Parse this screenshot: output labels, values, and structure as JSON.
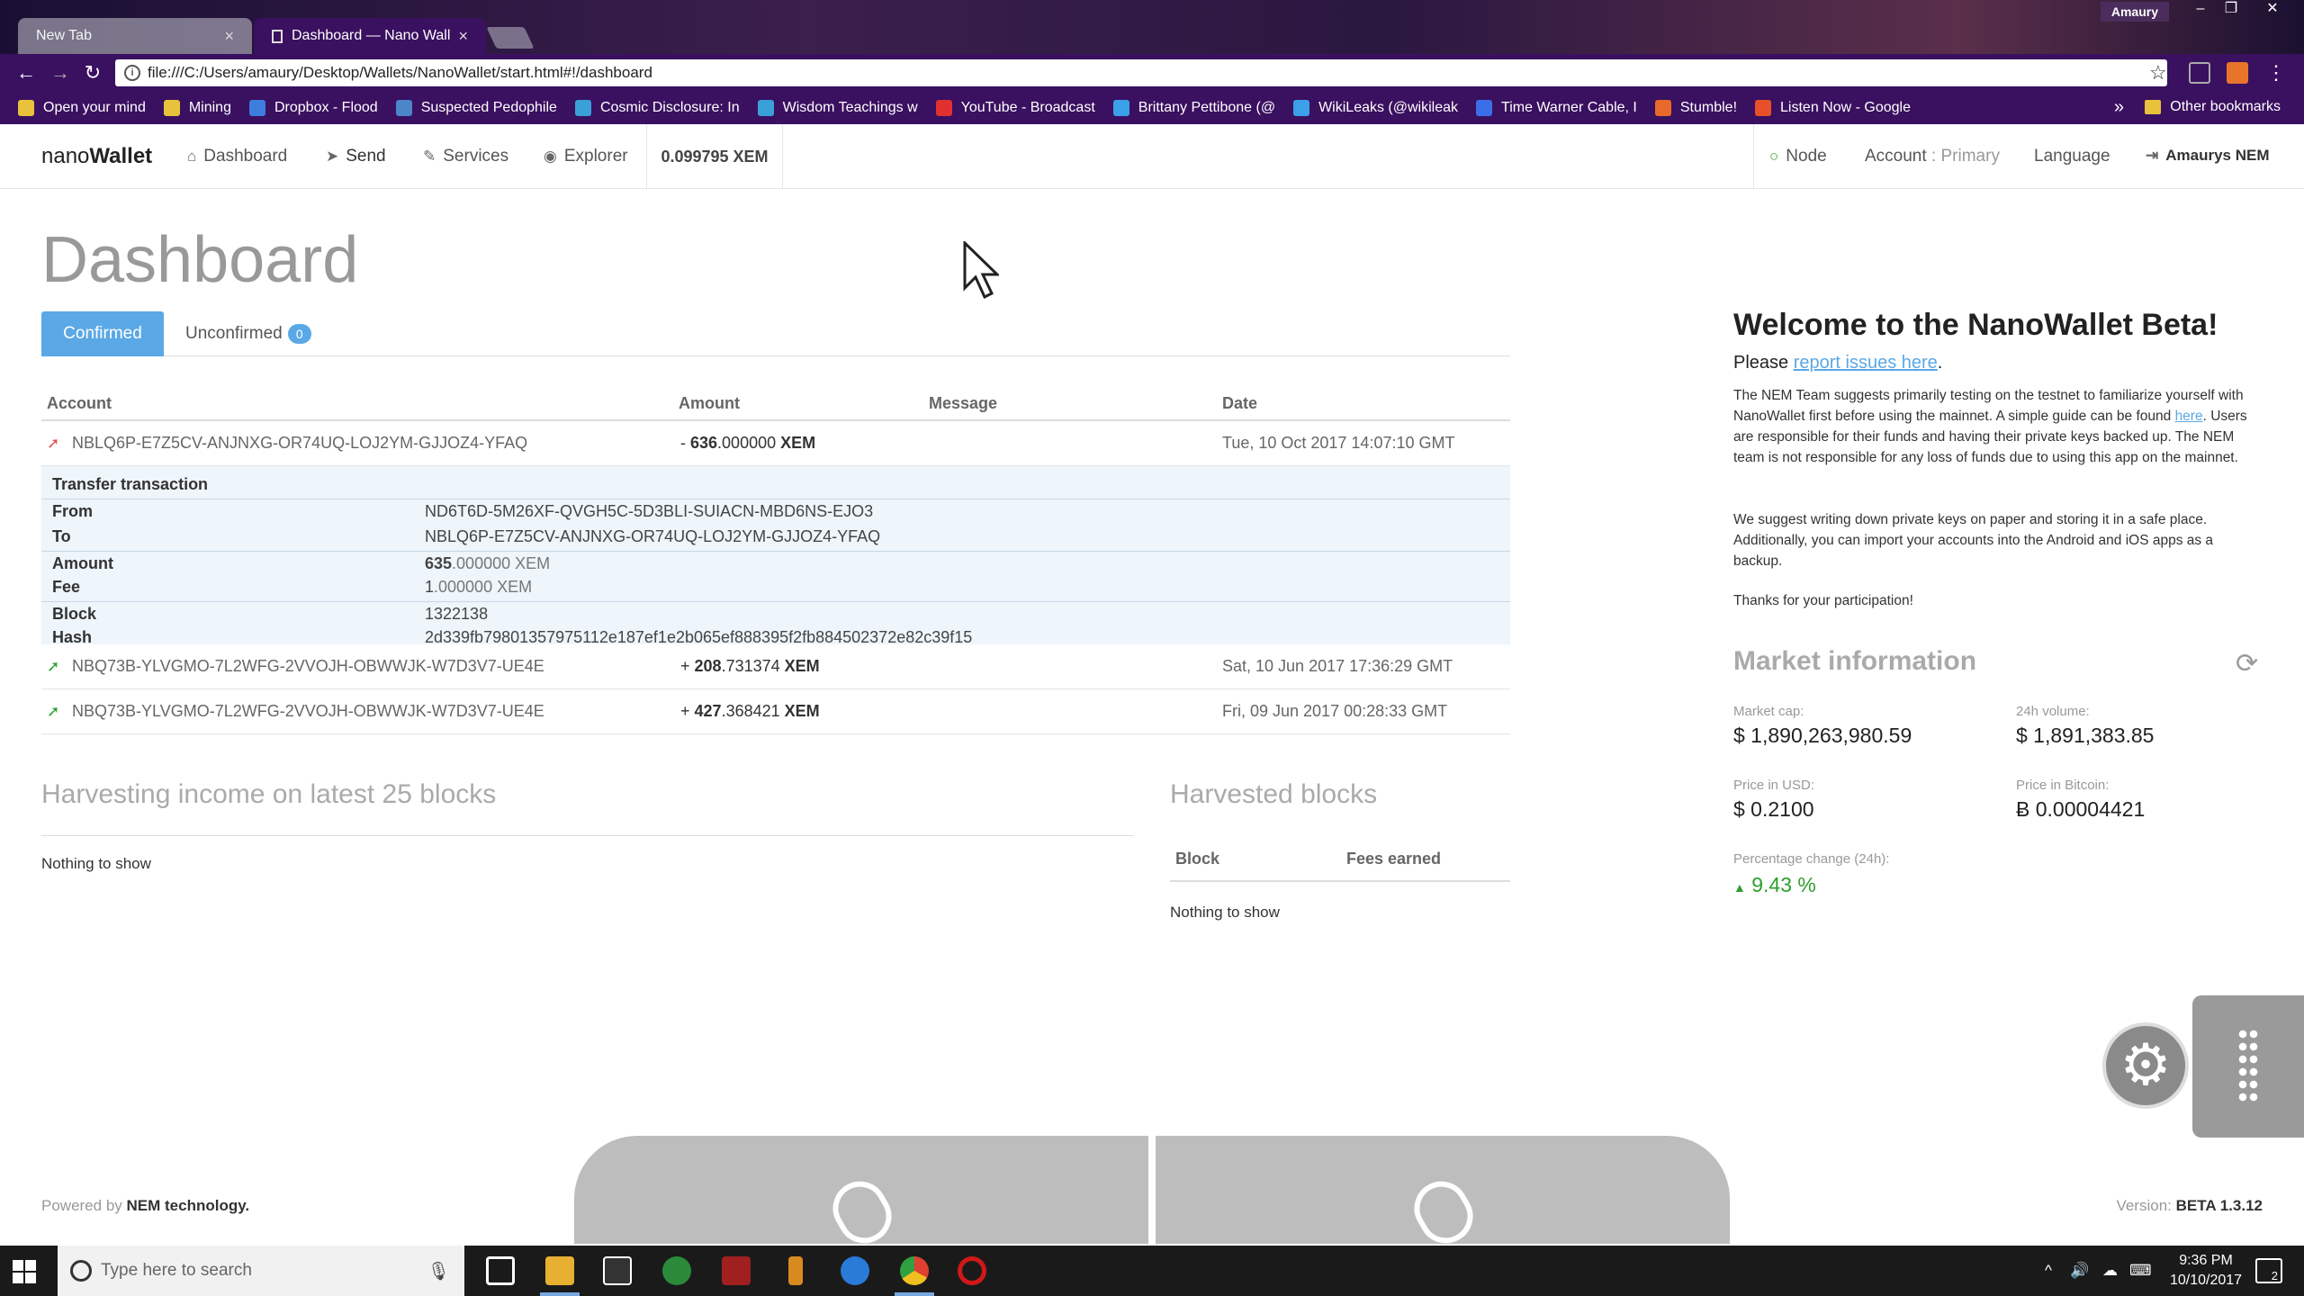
{
  "browser": {
    "tabs": [
      {
        "title": "New Tab"
      },
      {
        "title": "Dashboard — Nano Wall"
      }
    ],
    "user": "Amaury",
    "url": "file:///C:/Users/amaury/Desktop/Wallets/NanoWallet/start.html#!/dashboard",
    "bookmarks": [
      {
        "label": "Open your mind",
        "color": "#e8c23a"
      },
      {
        "label": "Mining",
        "color": "#e8c23a"
      },
      {
        "label": "Dropbox - Flood",
        "color": "#3d7dde"
      },
      {
        "label": "Suspected Pedophile",
        "color": "#4a86c8"
      },
      {
        "label": "Cosmic Disclosure: In",
        "color": "#3aa0d8"
      },
      {
        "label": "Wisdom Teachings w",
        "color": "#3aa0d8"
      },
      {
        "label": "YouTube - Broadcast",
        "color": "#e03030"
      },
      {
        "label": "Brittany Pettibone (@",
        "color": "#3aa0e8"
      },
      {
        "label": "WikiLeaks (@wikileak",
        "color": "#3aa0e8"
      },
      {
        "label": "Time Warner Cable, I",
        "color": "#3a6ee8"
      },
      {
        "label": "Stumble!",
        "color": "#e86a2a"
      },
      {
        "label": "Listen Now - Google",
        "color": "#e8502a"
      }
    ],
    "other_bookmarks": "Other bookmarks",
    "more": "»"
  },
  "nav": {
    "brand_prefix": "nano",
    "brand_suffix": "Wallet",
    "dashboard": "Dashboard",
    "send": "Send",
    "services": "Services",
    "explorer": "Explorer",
    "balance": "0.099795 XEM",
    "node": "Node",
    "account_label": "Account",
    "account_value": ": Primary",
    "language": "Language",
    "user": "Amaurys NEM"
  },
  "dashboard": {
    "title": "Dashboard",
    "tab_confirmed": "Confirmed",
    "tab_unconfirmed": "Unconfirmed",
    "unconfirmed_count": "0",
    "columns": {
      "account": "Account",
      "amount": "Amount",
      "message": "Message",
      "date": "Date"
    },
    "transactions": [
      {
        "account": "NBLQ6P-E7Z5CV-ANJNXG-OR74UQ-LOJ2YM-GJJOZ4-YFAQ",
        "sign": "- ",
        "int": "636",
        "dec": ".000000",
        "unit": " XEM",
        "date": "Tue, 10 Oct 2017 14:07:10 GMT",
        "direction": "out"
      },
      {
        "account": "NBQ73B-YLVGMO-7L2WFG-2VVOJH-OBWWJK-W7D3V7-UE4E",
        "sign": "+ ",
        "int": "208",
        "dec": ".731374",
        "unit": " XEM",
        "date": "Sat, 10 Jun 2017 17:36:29 GMT",
        "direction": "in"
      },
      {
        "account": "NBQ73B-YLVGMO-7L2WFG-2VVOJH-OBWWJK-W7D3V7-UE4E",
        "sign": "+ ",
        "int": "427",
        "dec": ".368421",
        "unit": " XEM",
        "date": "Fri, 09 Jun 2017 00:28:33 GMT",
        "direction": "in"
      }
    ],
    "detail": {
      "heading": "Transfer transaction",
      "from_label": "From",
      "from": "ND6T6D-5M26XF-QVGH5C-5D3BLI-SUIACN-MBD6NS-EJO3",
      "to_label": "To",
      "to": "NBLQ6P-E7Z5CV-ANJNXG-OR74UQ-LOJ2YM-GJJOZ4-YFAQ",
      "amount_label": "Amount",
      "amount_int": "635",
      "amount_dec": ".000000 XEM",
      "fee_label": "Fee",
      "fee_int": "1",
      "fee_dec": ".000000 XEM",
      "block_label": "Block",
      "block": "1322138",
      "hash_label": "Hash",
      "hash": "2d339fb79801357975112e187ef1e2b065ef888395f2fb884502372e82c39f15"
    },
    "harvest_income_title": "Harvesting income on latest 25 blocks",
    "harvest_income_empty": "Nothing to show",
    "harvested_title": "Harvested blocks",
    "harvested_col_block": "Block",
    "harvested_col_fees": "Fees earned",
    "harvested_empty": "Nothing to show"
  },
  "welcome": {
    "title": "Welcome to the NanoWallet Beta!",
    "please": "Please",
    "report_link": "report issues here",
    "period": ".",
    "p1a": "The NEM Team suggests primarily testing on the testnet to familiarize yourself with NanoWallet first before using the mainnet. A simple guide can be found",
    "here_link": "here",
    "p1b": ". Users are responsible for their funds and having their private keys backed up. The NEM team is not responsible for any loss of funds due to using this app on the mainnet.",
    "p2": "We suggest writing down private keys on paper and storing it in a safe place. Additionally, you can import your accounts into the Android and iOS apps as a backup.",
    "p3": "Thanks for your participation!"
  },
  "market": {
    "title": "Market information",
    "market_cap_label": "Market cap:",
    "market_cap": "$ 1,890,263,980.59",
    "volume_label": "24h volume:",
    "volume": "$ 1,891,383.85",
    "usd_label": "Price in USD:",
    "usd": "$ 0.2100",
    "btc_label": "Price in Bitcoin:",
    "btc": "Ƀ 0.00004421",
    "change_label": "Percentage change (24h):",
    "change": "9.43 %"
  },
  "footer": {
    "powered": "Powered by",
    "nem": "NEM technology.",
    "version_label": "Version:",
    "version": "BETA 1.3.12"
  },
  "taskbar": {
    "search_placeholder": "Type here to search",
    "time": "9:36 PM",
    "date": "10/10/2017",
    "notifications": "2"
  }
}
